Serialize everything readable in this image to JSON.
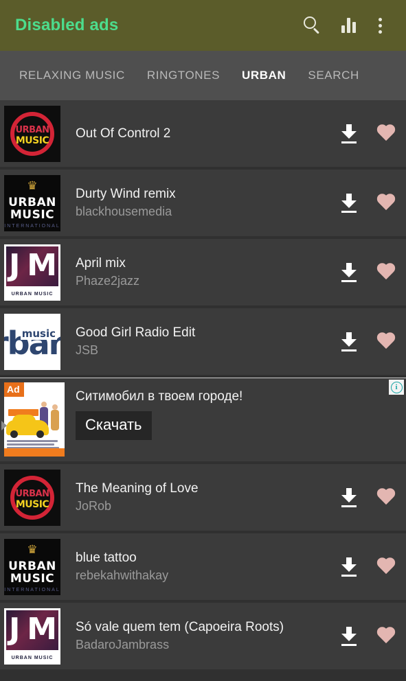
{
  "appbar": {
    "title": "Disabled ads",
    "title_color": "#4cdd8d",
    "bg_color": "#5b5c2a",
    "actions": [
      {
        "name": "search-icon",
        "label": "Search"
      },
      {
        "name": "equalizer-icon",
        "label": "Charts"
      },
      {
        "name": "overflow-menu-icon",
        "label": "More options"
      }
    ]
  },
  "tabs": {
    "active_index": 2,
    "indicator_color": "#4cb883",
    "items": [
      {
        "label": "RELAXING MUSIC"
      },
      {
        "label": "RINGTONES"
      },
      {
        "label": "URBAN"
      },
      {
        "label": "SEARCH"
      }
    ]
  },
  "list": {
    "download_label": "Download",
    "favorite_label": "Favorite",
    "heart_color": "#e3b6b1",
    "items": [
      {
        "title": "Out Of Control 2",
        "artist": "",
        "art": "urban-music-circle"
      },
      {
        "title": "Durty Wind remix",
        "artist": "blackhousemedia",
        "art": "urban-music-crown"
      },
      {
        "title": "April mix",
        "artist": "Phaze2jazz",
        "art": "jam-urban-music"
      },
      {
        "title": "Good Girl Radio Edit",
        "artist": "JSB",
        "art": "urban-music-blue"
      },
      {
        "title": "The Meaning of Love",
        "artist": "JoRob",
        "art": "urban-music-circle"
      },
      {
        "title": "blue tattoo",
        "artist": "rebekahwithakay",
        "art": "urban-music-crown"
      },
      {
        "title": "Só vale quem tem (Capoeira Roots)",
        "artist": "BadaroJambrass",
        "art": "jam-urban-music"
      }
    ]
  },
  "ad": {
    "badge": "Ad",
    "badge_color": "#e8701a",
    "headline": "Ситимобил в твоем городе!",
    "cta": "Скачать",
    "info_glyph": "i",
    "info_color": "#1aa6a6",
    "creative": {
      "brand": "Citymobil",
      "art": "taxi-illustration"
    }
  },
  "artwork": {
    "circle": {
      "line1": "URBAN",
      "line2": "MUSIC"
    },
    "crown": {
      "crown_glyph": "♛",
      "line1": "URBAN",
      "line2": "MUSIC",
      "line3": "INTERNATIONAL"
    },
    "jam": {
      "left": "J",
      "right": "M",
      "caption": "URBAN MUSIC"
    },
    "blue": {
      "big": "rban",
      "small": "music"
    }
  }
}
